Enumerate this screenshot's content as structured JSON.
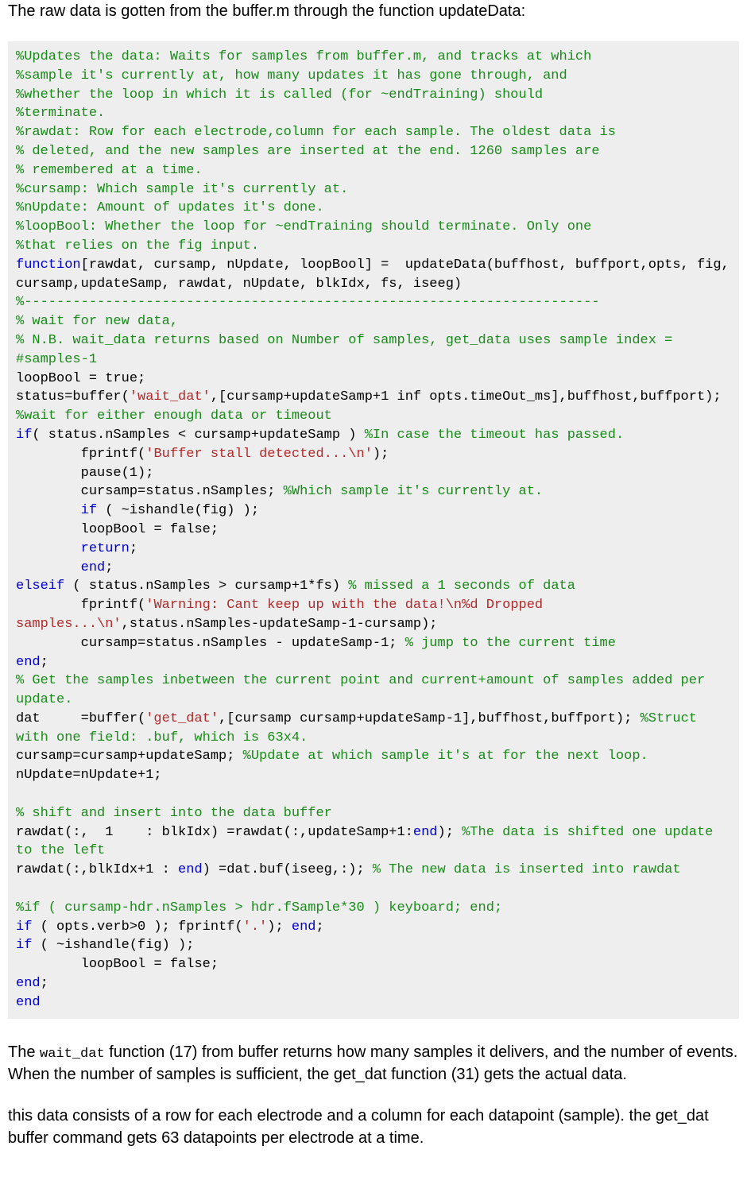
{
  "intro_text": "The raw data is gotten from the buffer.m through the function updateData:",
  "outro": {
    "p1_a": "The ",
    "p1_code": "wait_dat",
    "p1_b": " function (17) from buffer returns how many samples it delivers, and the number of events. When the number of samples is sufficient, the get_dat function (31) gets the actual data.",
    "p2": "this data consists of a row for each electrode and a column for each datapoint (sample). the get_dat buffer command gets 63 datapoints per electrode at a time."
  },
  "code": [
    [
      {
        "c": "c-comment",
        "t": "%Updates the data: Waits for samples from buffer.m, and tracks at which"
      }
    ],
    [
      {
        "c": "c-comment",
        "t": "%sample it's currently at, how many updates it has gone through, and"
      }
    ],
    [
      {
        "c": "c-comment",
        "t": "%whether the loop in which it is called (for ~endTraining) should"
      }
    ],
    [
      {
        "c": "c-comment",
        "t": "%terminate."
      }
    ],
    [
      {
        "c": "c-comment",
        "t": "%rawdat: Row for each electrode,column for each sample. The oldest data is"
      }
    ],
    [
      {
        "c": "c-comment",
        "t": "% deleted, and the new samples are inserted at the end. 1260 samples are"
      }
    ],
    [
      {
        "c": "c-comment",
        "t": "% remembered at a time."
      }
    ],
    [
      {
        "c": "c-comment",
        "t": "%cursamp: Which sample it's currently at."
      }
    ],
    [
      {
        "c": "c-comment",
        "t": "%nUpdate: Amount of updates it's done."
      }
    ],
    [
      {
        "c": "c-comment",
        "t": "%loopBool: Whether the loop for ~endTraining should terminate. Only one"
      }
    ],
    [
      {
        "c": "c-comment",
        "t": "%that relies on the fig input."
      }
    ],
    [
      {
        "c": "c-keyword",
        "t": "function"
      },
      {
        "c": "c-default",
        "t": "[rawdat, cursamp, nUpdate, loopBool] =  updateData(buffhost, buffport,opts, fig, cursamp,updateSamp, rawdat, nUpdate, blkIdx, fs, iseeg)"
      }
    ],
    [
      {
        "c": "c-comment",
        "t": "%-----------------------------------------------------------------------"
      }
    ],
    [
      {
        "c": "c-comment",
        "t": "% wait for new data,"
      }
    ],
    [
      {
        "c": "c-comment",
        "t": "% N.B. wait_data returns based on Number of samples, get_data uses sample index = #samples-1"
      }
    ],
    [
      {
        "c": "c-default",
        "t": "loopBool = true;"
      }
    ],
    [
      {
        "c": "c-default",
        "t": "status=buffer("
      },
      {
        "c": "c-string",
        "t": "'wait_dat'"
      },
      {
        "c": "c-default",
        "t": ",[cursamp+updateSamp+1 inf opts.timeOut_ms],buffhost,buffport); "
      },
      {
        "c": "c-comment",
        "t": "%wait for either enough data or timeout"
      }
    ],
    [
      {
        "c": "c-keyword",
        "t": "if"
      },
      {
        "c": "c-default",
        "t": "( status.nSamples < cursamp+updateSamp ) "
      },
      {
        "c": "c-comment",
        "t": "%In case the timeout has passed."
      }
    ],
    [
      {
        "c": "c-default",
        "t": "        fprintf("
      },
      {
        "c": "c-string",
        "t": "'Buffer stall detected...\\n'"
      },
      {
        "c": "c-default",
        "t": ");"
      }
    ],
    [
      {
        "c": "c-default",
        "t": "        pause(1);"
      }
    ],
    [
      {
        "c": "c-default",
        "t": "        cursamp=status.nSamples; "
      },
      {
        "c": "c-comment",
        "t": "%Which sample it's currently at."
      }
    ],
    [
      {
        "c": "c-default",
        "t": "        "
      },
      {
        "c": "c-keyword",
        "t": "if"
      },
      {
        "c": "c-default",
        "t": " ( ~ishandle(fig) );"
      }
    ],
    [
      {
        "c": "c-default",
        "t": "        loopBool = false;"
      }
    ],
    [
      {
        "c": "c-default",
        "t": "        "
      },
      {
        "c": "c-keyword",
        "t": "return"
      },
      {
        "c": "c-default",
        "t": ";"
      }
    ],
    [
      {
        "c": "c-default",
        "t": "        "
      },
      {
        "c": "c-keyword",
        "t": "end"
      },
      {
        "c": "c-default",
        "t": ";"
      }
    ],
    [
      {
        "c": "c-keyword",
        "t": "elseif"
      },
      {
        "c": "c-default",
        "t": " ( status.nSamples > cursamp+1*fs) "
      },
      {
        "c": "c-comment",
        "t": "% missed a 1 seconds of data"
      }
    ],
    [
      {
        "c": "c-default",
        "t": "        fprintf("
      },
      {
        "c": "c-string",
        "t": "'Warning: Cant keep up with the data!\\n%d Dropped samples...\\n'"
      },
      {
        "c": "c-default",
        "t": ",status.nSamples-updateSamp-1-cursamp);"
      }
    ],
    [
      {
        "c": "c-default",
        "t": "        cursamp=status.nSamples - updateSamp-1; "
      },
      {
        "c": "c-comment",
        "t": "% jump to the current time"
      }
    ],
    [
      {
        "c": "c-keyword",
        "t": "end"
      },
      {
        "c": "c-default",
        "t": ";"
      }
    ],
    [
      {
        "c": "c-comment",
        "t": "% Get the samples inbetween the current point and current+amount of samples added per update."
      }
    ],
    [
      {
        "c": "c-default",
        "t": "dat     =buffer("
      },
      {
        "c": "c-string",
        "t": "'get_dat'"
      },
      {
        "c": "c-default",
        "t": ",[cursamp cursamp+updateSamp-1],buffhost,buffport); "
      },
      {
        "c": "c-comment",
        "t": "%Struct with one field: .buf, which is 63x4."
      }
    ],
    [
      {
        "c": "c-default",
        "t": "cursamp=cursamp+updateSamp; "
      },
      {
        "c": "c-comment",
        "t": "%Update at which sample it's at for the next loop."
      }
    ],
    [
      {
        "c": "c-default",
        "t": "nUpdate=nUpdate+1;"
      }
    ],
    [],
    [
      {
        "c": "c-comment",
        "t": "% shift and insert into the data buffer"
      }
    ],
    [
      {
        "c": "c-default",
        "t": "rawdat(:,  1    : blkIdx) =rawdat(:,updateSamp+1:"
      },
      {
        "c": "c-keyword",
        "t": "end"
      },
      {
        "c": "c-default",
        "t": "); "
      },
      {
        "c": "c-comment",
        "t": "%The data is shifted one update to the left"
      }
    ],
    [
      {
        "c": "c-default",
        "t": "rawdat(:,blkIdx+1 : "
      },
      {
        "c": "c-keyword",
        "t": "end"
      },
      {
        "c": "c-default",
        "t": ") =dat.buf(iseeg,:); "
      },
      {
        "c": "c-comment",
        "t": "% The new data is inserted into rawdat"
      }
    ],
    [],
    [
      {
        "c": "c-comment",
        "t": "%if ( cursamp-hdr.nSamples > hdr.fSample*30 ) keyboard; end;"
      }
    ],
    [
      {
        "c": "c-keyword",
        "t": "if"
      },
      {
        "c": "c-default",
        "t": " ( opts.verb>0 ); fprintf("
      },
      {
        "c": "c-string",
        "t": "'.'"
      },
      {
        "c": "c-default",
        "t": "); "
      },
      {
        "c": "c-keyword",
        "t": "end"
      },
      {
        "c": "c-default",
        "t": ";"
      }
    ],
    [
      {
        "c": "c-keyword",
        "t": "if"
      },
      {
        "c": "c-default",
        "t": " ( ~ishandle(fig) );"
      }
    ],
    [
      {
        "c": "c-default",
        "t": "        loopBool = false;"
      }
    ],
    [
      {
        "c": "c-keyword",
        "t": "end"
      },
      {
        "c": "c-default",
        "t": ";"
      }
    ],
    [
      {
        "c": "c-keyword",
        "t": "end"
      }
    ]
  ]
}
